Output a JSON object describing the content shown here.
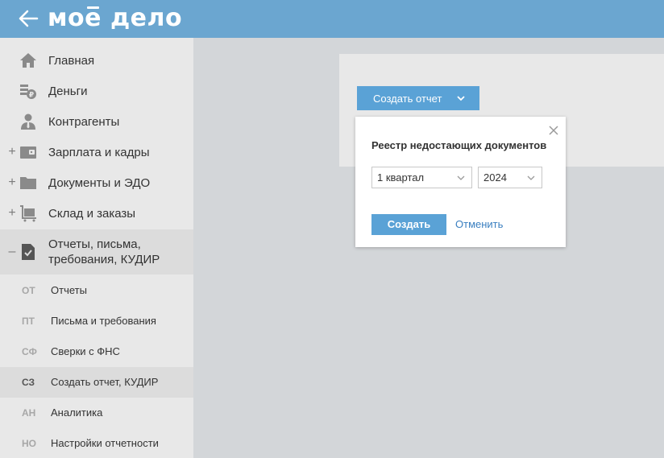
{
  "header": {
    "logo_text_pre": "мо",
    "logo_text_e": "е",
    "logo_text_post": " дело"
  },
  "sidebar": {
    "items": [
      {
        "label": "Главная",
        "icon": "home-icon",
        "expandable": false
      },
      {
        "label": "Деньги",
        "icon": "money-icon",
        "expandable": false
      },
      {
        "label": "Контрагенты",
        "icon": "contractors-icon",
        "expandable": false
      },
      {
        "label": "Зарплата и кадры",
        "icon": "wallet-icon",
        "expandable": true,
        "expand_symbol": "+"
      },
      {
        "label": "Документы и ЭДО",
        "icon": "folder-icon",
        "expandable": true,
        "expand_symbol": "+"
      },
      {
        "label": "Склад и заказы",
        "icon": "warehouse-icon",
        "expandable": true,
        "expand_symbol": "+"
      },
      {
        "label": "Отчеты, письма,\nтребования, КУДИР",
        "icon": "report-doc-icon",
        "expandable": true,
        "expand_symbol": "–"
      }
    ],
    "subitems": [
      {
        "abbr": "ОТ",
        "label": "Отчеты"
      },
      {
        "abbr": "ПТ",
        "label": "Письма и требования"
      },
      {
        "abbr": "СФ",
        "label": "Сверки с ФНС"
      },
      {
        "abbr": "СЗ",
        "label": "Создать отчет, КУДИР"
      },
      {
        "abbr": "АН",
        "label": "Аналитика"
      },
      {
        "abbr": "НО",
        "label": "Настройки отчетности"
      }
    ]
  },
  "main": {
    "create_report_label": "Создать отчет"
  },
  "popup": {
    "title": "Реестр недостающих документов",
    "quarter_value": "1 квартал",
    "year_value": "2024",
    "create_label": "Создать",
    "cancel_label": "Отменить"
  },
  "colors": {
    "header": "#6ba6d0",
    "accent": "#5aa2d6",
    "link": "#3a7fc0"
  }
}
